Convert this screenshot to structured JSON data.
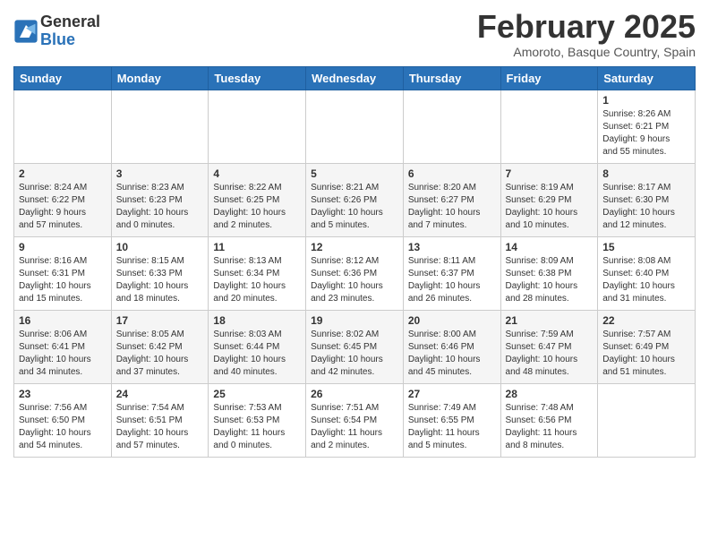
{
  "header": {
    "logo_general": "General",
    "logo_blue": "Blue",
    "month_title": "February 2025",
    "location": "Amoroto, Basque Country, Spain"
  },
  "weekdays": [
    "Sunday",
    "Monday",
    "Tuesday",
    "Wednesday",
    "Thursday",
    "Friday",
    "Saturday"
  ],
  "weeks": [
    [
      {
        "day": "",
        "info": ""
      },
      {
        "day": "",
        "info": ""
      },
      {
        "day": "",
        "info": ""
      },
      {
        "day": "",
        "info": ""
      },
      {
        "day": "",
        "info": ""
      },
      {
        "day": "",
        "info": ""
      },
      {
        "day": "1",
        "info": "Sunrise: 8:26 AM\nSunset: 6:21 PM\nDaylight: 9 hours\nand 55 minutes."
      }
    ],
    [
      {
        "day": "2",
        "info": "Sunrise: 8:24 AM\nSunset: 6:22 PM\nDaylight: 9 hours\nand 57 minutes."
      },
      {
        "day": "3",
        "info": "Sunrise: 8:23 AM\nSunset: 6:23 PM\nDaylight: 10 hours\nand 0 minutes."
      },
      {
        "day": "4",
        "info": "Sunrise: 8:22 AM\nSunset: 6:25 PM\nDaylight: 10 hours\nand 2 minutes."
      },
      {
        "day": "5",
        "info": "Sunrise: 8:21 AM\nSunset: 6:26 PM\nDaylight: 10 hours\nand 5 minutes."
      },
      {
        "day": "6",
        "info": "Sunrise: 8:20 AM\nSunset: 6:27 PM\nDaylight: 10 hours\nand 7 minutes."
      },
      {
        "day": "7",
        "info": "Sunrise: 8:19 AM\nSunset: 6:29 PM\nDaylight: 10 hours\nand 10 minutes."
      },
      {
        "day": "8",
        "info": "Sunrise: 8:17 AM\nSunset: 6:30 PM\nDaylight: 10 hours\nand 12 minutes."
      }
    ],
    [
      {
        "day": "9",
        "info": "Sunrise: 8:16 AM\nSunset: 6:31 PM\nDaylight: 10 hours\nand 15 minutes."
      },
      {
        "day": "10",
        "info": "Sunrise: 8:15 AM\nSunset: 6:33 PM\nDaylight: 10 hours\nand 18 minutes."
      },
      {
        "day": "11",
        "info": "Sunrise: 8:13 AM\nSunset: 6:34 PM\nDaylight: 10 hours\nand 20 minutes."
      },
      {
        "day": "12",
        "info": "Sunrise: 8:12 AM\nSunset: 6:36 PM\nDaylight: 10 hours\nand 23 minutes."
      },
      {
        "day": "13",
        "info": "Sunrise: 8:11 AM\nSunset: 6:37 PM\nDaylight: 10 hours\nand 26 minutes."
      },
      {
        "day": "14",
        "info": "Sunrise: 8:09 AM\nSunset: 6:38 PM\nDaylight: 10 hours\nand 28 minutes."
      },
      {
        "day": "15",
        "info": "Sunrise: 8:08 AM\nSunset: 6:40 PM\nDaylight: 10 hours\nand 31 minutes."
      }
    ],
    [
      {
        "day": "16",
        "info": "Sunrise: 8:06 AM\nSunset: 6:41 PM\nDaylight: 10 hours\nand 34 minutes."
      },
      {
        "day": "17",
        "info": "Sunrise: 8:05 AM\nSunset: 6:42 PM\nDaylight: 10 hours\nand 37 minutes."
      },
      {
        "day": "18",
        "info": "Sunrise: 8:03 AM\nSunset: 6:44 PM\nDaylight: 10 hours\nand 40 minutes."
      },
      {
        "day": "19",
        "info": "Sunrise: 8:02 AM\nSunset: 6:45 PM\nDaylight: 10 hours\nand 42 minutes."
      },
      {
        "day": "20",
        "info": "Sunrise: 8:00 AM\nSunset: 6:46 PM\nDaylight: 10 hours\nand 45 minutes."
      },
      {
        "day": "21",
        "info": "Sunrise: 7:59 AM\nSunset: 6:47 PM\nDaylight: 10 hours\nand 48 minutes."
      },
      {
        "day": "22",
        "info": "Sunrise: 7:57 AM\nSunset: 6:49 PM\nDaylight: 10 hours\nand 51 minutes."
      }
    ],
    [
      {
        "day": "23",
        "info": "Sunrise: 7:56 AM\nSunset: 6:50 PM\nDaylight: 10 hours\nand 54 minutes."
      },
      {
        "day": "24",
        "info": "Sunrise: 7:54 AM\nSunset: 6:51 PM\nDaylight: 10 hours\nand 57 minutes."
      },
      {
        "day": "25",
        "info": "Sunrise: 7:53 AM\nSunset: 6:53 PM\nDaylight: 11 hours\nand 0 minutes."
      },
      {
        "day": "26",
        "info": "Sunrise: 7:51 AM\nSunset: 6:54 PM\nDaylight: 11 hours\nand 2 minutes."
      },
      {
        "day": "27",
        "info": "Sunrise: 7:49 AM\nSunset: 6:55 PM\nDaylight: 11 hours\nand 5 minutes."
      },
      {
        "day": "28",
        "info": "Sunrise: 7:48 AM\nSunset: 6:56 PM\nDaylight: 11 hours\nand 8 minutes."
      },
      {
        "day": "",
        "info": ""
      }
    ]
  ]
}
